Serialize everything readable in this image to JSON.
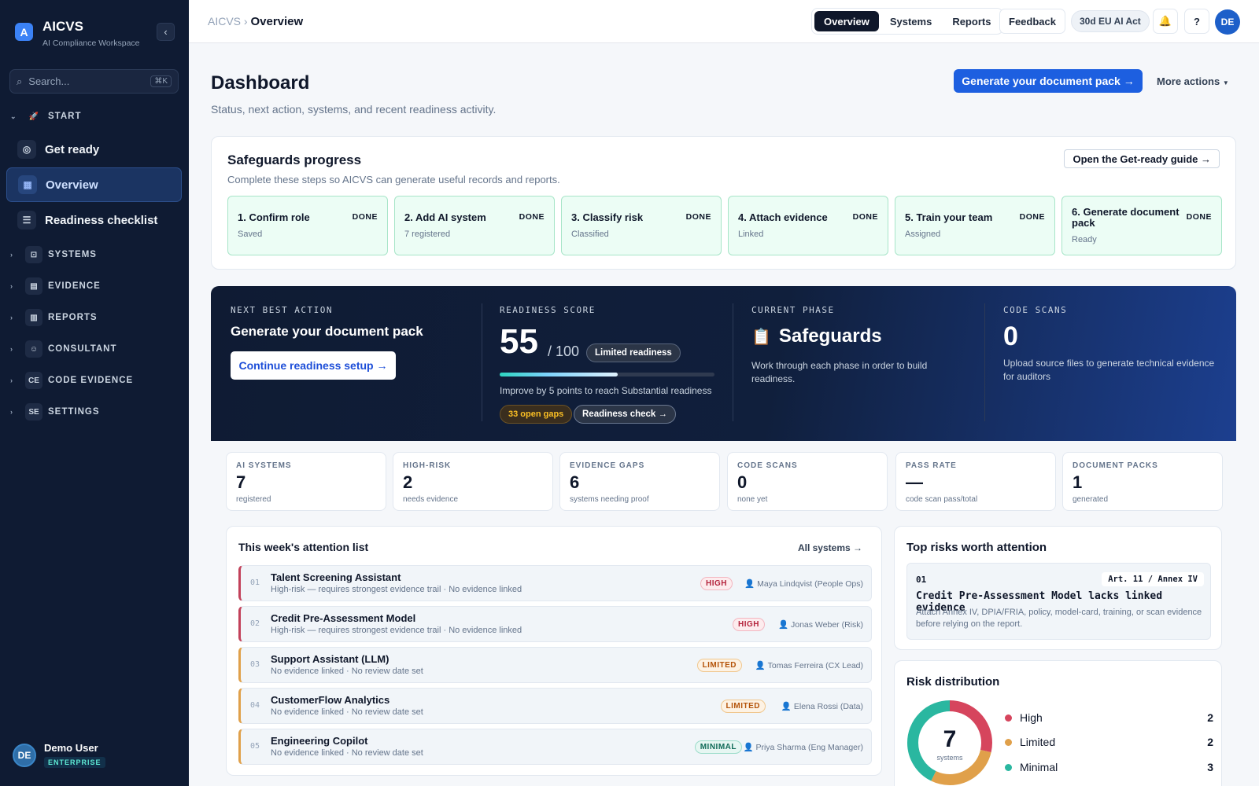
{
  "app": {
    "name": "AICVS",
    "subtitle": "AI Compliance Workspace",
    "logo_letter": "A"
  },
  "sidebar": {
    "search_placeholder": "Search...",
    "search_shortcut": "⌘K",
    "sections": [
      {
        "label": "START",
        "icon": "rocket-icon"
      },
      {
        "label": "SYSTEMS",
        "icon": "robot-icon"
      },
      {
        "label": "EVIDENCE",
        "icon": "archive-icon"
      },
      {
        "label": "REPORTS",
        "icon": "bar-chart-icon"
      },
      {
        "label": "CONSULTANT",
        "icon": "users-icon"
      },
      {
        "label": "CODE EVIDENCE",
        "icon_text": "CE"
      },
      {
        "label": "SETTINGS",
        "icon_text": "SE"
      }
    ],
    "items": [
      {
        "label": "Get ready",
        "icon": "compass-icon"
      },
      {
        "label": "Overview",
        "icon": "grid-icon",
        "active": true
      },
      {
        "label": "Readiness checklist",
        "icon": "checklist-icon"
      }
    ],
    "user": {
      "name": "Demo User",
      "initials": "DE",
      "plan": "ENTERPRISE"
    }
  },
  "topbar": {
    "breadcrumb_root": "AICVS",
    "breadcrumb_current": "Overview",
    "tabs": [
      "Overview",
      "Systems",
      "Reports"
    ],
    "active_tab": "Overview",
    "feedback": "Feedback",
    "regulation_pill": "30d EU AI Act",
    "help": "?",
    "avatar": "DE"
  },
  "page": {
    "title": "Dashboard",
    "subtitle": "Status, next action, systems, and recent readiness activity.",
    "primary_action": "Generate your document pack →",
    "more_actions": "More actions"
  },
  "safeguards": {
    "title": "Safeguards progress",
    "subtitle": "Complete these steps so AICVS can generate useful records and reports.",
    "guide_button": "Open the Get-ready guide →",
    "steps": [
      {
        "title": "1. Confirm role",
        "sub": "Saved",
        "status": "DONE"
      },
      {
        "title": "2. Add AI system",
        "sub": "7 registered",
        "status": "DONE"
      },
      {
        "title": "3. Classify risk",
        "sub": "Classified",
        "status": "DONE"
      },
      {
        "title": "4. Attach evidence",
        "sub": "Linked",
        "status": "DONE"
      },
      {
        "title": "5. Train your team",
        "sub": "Assigned",
        "status": "DONE"
      },
      {
        "title": "6. Generate document pack",
        "sub": "Ready",
        "status": "DONE"
      }
    ]
  },
  "hero": {
    "next_label": "NEXT BEST ACTION",
    "next_action": "Generate your document pack",
    "continue_button": "Continue readiness setup →",
    "score_label": "READINESS SCORE",
    "score": "55",
    "score_max": "/ 100",
    "score_value": 55,
    "score_badge": "Limited readiness",
    "improve_text": "Improve by 5 points to reach Substantial readiness",
    "gaps_pill": "33 open gaps",
    "readiness_check": "Readiness check →",
    "phase_label": "CURRENT PHASE",
    "phase": "Safeguards",
    "phase_desc": "Work through each phase in order to build readiness.",
    "scans_label": "CODE SCANS",
    "scans": "0",
    "scans_desc": "Upload source files to generate technical evidence for auditors"
  },
  "stats": [
    {
      "label": "AI SYSTEMS",
      "value": "7",
      "note": "registered"
    },
    {
      "label": "HIGH-RISK",
      "value": "2",
      "note": "needs evidence"
    },
    {
      "label": "EVIDENCE GAPS",
      "value": "6",
      "note": "systems needing proof"
    },
    {
      "label": "CODE SCANS",
      "value": "0",
      "note": "none yet"
    },
    {
      "label": "PASS RATE",
      "value": "—",
      "note": "code scan pass/total"
    },
    {
      "label": "DOCUMENT PACKS",
      "value": "1",
      "note": "generated"
    }
  ],
  "attention": {
    "title": "This week's attention list",
    "all_link": "All systems →",
    "rows": [
      {
        "num": "01",
        "title": "Talent Screening Assistant",
        "sub": "High-risk — requires strongest evidence trail · No evidence linked",
        "badge": "HIGH",
        "owner": "Maya Lindqvist (People Ops)"
      },
      {
        "num": "02",
        "title": "Credit Pre-Assessment Model",
        "sub": "High-risk — requires strongest evidence trail · No evidence linked",
        "badge": "HIGH",
        "owner": "Jonas Weber (Risk)"
      },
      {
        "num": "03",
        "title": "Support Assistant (LLM)",
        "sub": "No evidence linked · No review date set",
        "badge": "LIMITED",
        "owner": "Tomas Ferreira (CX Lead)"
      },
      {
        "num": "04",
        "title": "CustomerFlow Analytics",
        "sub": "No evidence linked · No review date set",
        "badge": "LIMITED",
        "owner": "Elena Rossi (Data)"
      },
      {
        "num": "05",
        "title": "Engineering Copilot",
        "sub": "No evidence linked · No review date set",
        "badge": "MINIMAL",
        "owner": "Priya Sharma (Eng Manager)"
      }
    ]
  },
  "top_risks": {
    "title": "Top risks worth attention",
    "items": [
      {
        "num": "01",
        "article": "Art. 11 / Annex IV",
        "title": "Credit Pre-Assessment Model lacks linked evidence",
        "desc": "Attach Annex IV, DPIA/FRIA, policy, model-card, training, or scan evidence before relying on the report."
      }
    ]
  },
  "risk_distribution": {
    "title": "Risk distribution",
    "total": "7",
    "total_label": "systems",
    "segments": [
      {
        "label": "High",
        "value": 2,
        "color": "#d6455d"
      },
      {
        "label": "Limited",
        "value": 2,
        "color": "#e0a04a"
      },
      {
        "label": "Minimal",
        "value": 3,
        "color": "#2ab7a0"
      }
    ]
  },
  "colors": {
    "accent": "#1d5fe0",
    "sidebar": "#0f1b33",
    "done_bg": "#ecfdf5"
  }
}
